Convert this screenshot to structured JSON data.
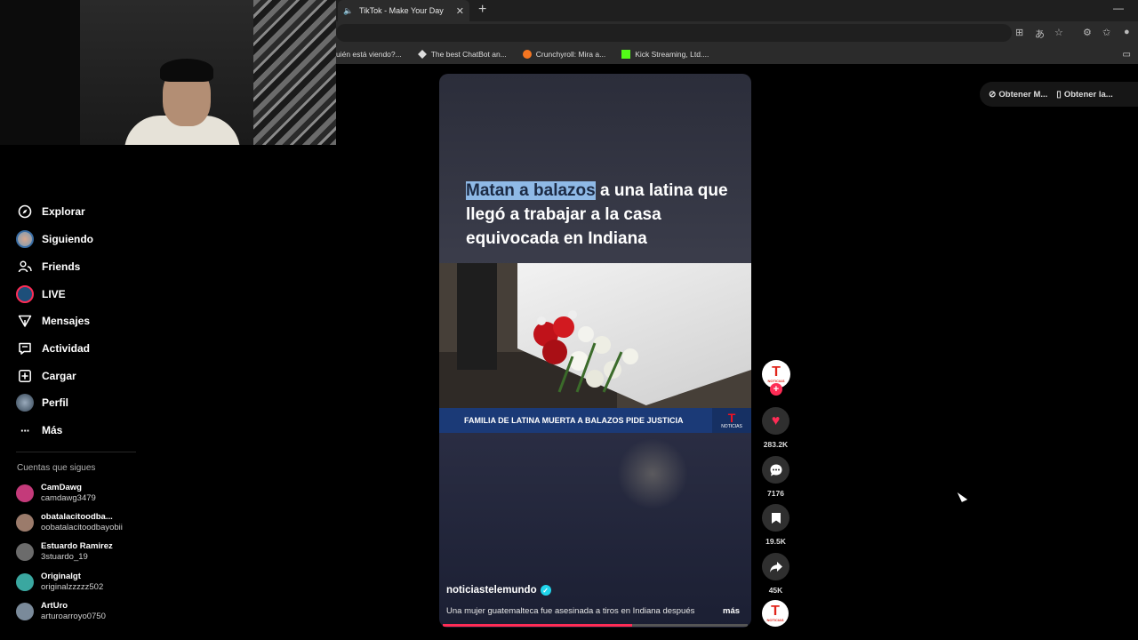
{
  "browser": {
    "tab_title": "TikTok - Make Your Day",
    "tab_close": "✕",
    "new_tab": "+",
    "minimize": "—",
    "bookmarks": [
      {
        "label": "uién está viendo?...",
        "icon": "page-icon"
      },
      {
        "label": "The best ChatBot an...",
        "icon": "chatbot-icon"
      },
      {
        "label": "Crunchyroll: Mira a...",
        "icon": "crunchyroll-icon",
        "color": "#f47521"
      },
      {
        "label": "Kick Streaming, Ltd....",
        "icon": "kick-icon",
        "color": "#53fc18"
      }
    ]
  },
  "sidebar": {
    "items": [
      {
        "label": "Explorar",
        "icon": "compass-icon"
      },
      {
        "label": "Siguiendo",
        "icon": "avatar-icon"
      },
      {
        "label": "Friends",
        "icon": "friends-icon"
      },
      {
        "label": "LIVE",
        "icon": "live-icon"
      },
      {
        "label": "Mensajes",
        "icon": "send-icon"
      },
      {
        "label": "Actividad",
        "icon": "activity-icon"
      },
      {
        "label": "Cargar",
        "icon": "upload-icon"
      },
      {
        "label": "Perfil",
        "icon": "profile-avatar-icon"
      },
      {
        "label": "Más",
        "icon": "more-icon"
      }
    ],
    "following_title": "Cuentas que sigues",
    "accounts": [
      {
        "name": "CamDawg",
        "handle": "camdawg3479",
        "color": "#c43a7a"
      },
      {
        "name": "obatalacitoodba...",
        "handle": "oobatalacitoodbayobii",
        "color": "#9b7b6b"
      },
      {
        "name": "Estuardo Ramirez",
        "handle": "3stuardo_19",
        "color": "#6b6b6b"
      },
      {
        "name": "Originalgt",
        "handle": "originalzzzzz502",
        "color": "#3aa7a0"
      },
      {
        "name": "ArtUro",
        "handle": "arturoarroyo0750",
        "color": "#7a8a9a"
      }
    ]
  },
  "video": {
    "headline_highlight": "Matan a balazos",
    "headline_rest": " a una latina que llegó a trabajar a la casa equivocada en Indiana",
    "lower_third": "FAMILIA DE LATINA MUERTA A BALAZOS PIDE JUSTICIA",
    "logo_letter": "T",
    "logo_text": "NOTICIAS",
    "author": "noticiastelemundo",
    "caption": "Una mujer guatemalteca fue asesinada a tiros en Indiana después",
    "more_label": "más",
    "progress": 0.62
  },
  "actions": {
    "likes": "283.2K",
    "comments": "7176",
    "saves": "19.5K",
    "shares": "45K",
    "follow_plus": "+"
  },
  "get_app": {
    "desktop": "Obtener M...",
    "mobile": "Obtener la..."
  }
}
